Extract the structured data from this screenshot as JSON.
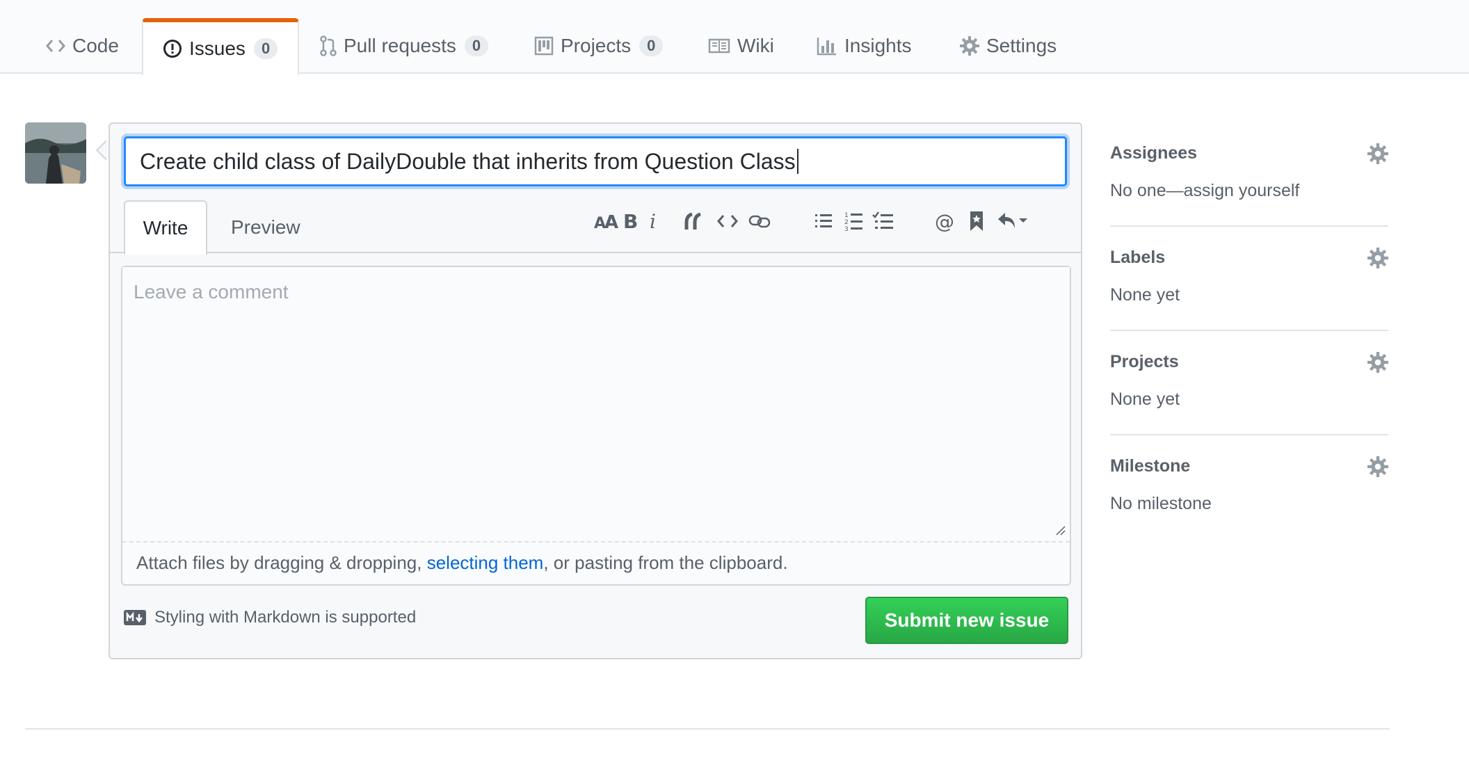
{
  "tabs": [
    {
      "label": "Code",
      "icon": "code-icon"
    },
    {
      "label": "Issues",
      "icon": "issue-opened-icon",
      "count": "0"
    },
    {
      "label": "Pull requests",
      "icon": "git-pull-request-icon",
      "count": "0"
    },
    {
      "label": "Projects",
      "icon": "project-icon",
      "count": "0"
    },
    {
      "label": "Wiki",
      "icon": "book-icon"
    },
    {
      "label": "Insights",
      "icon": "graph-icon"
    },
    {
      "label": "Settings",
      "icon": "gear-icon"
    }
  ],
  "issue": {
    "title_value": "Create child class of DailyDouble that inherits from Question Class",
    "write_tab": "Write",
    "preview_tab": "Preview",
    "comment_placeholder": "Leave a comment",
    "attach_prefix": "Attach files by dragging & dropping, ",
    "attach_link": "selecting them",
    "attach_suffix": ", or pasting from the clipboard.",
    "markdown_note": "Styling with Markdown is supported",
    "submit_label": "Submit new issue"
  },
  "toolbar": [
    "text-size-icon",
    "bold-icon",
    "italic-icon",
    "quote-icon",
    "code-icon",
    "link-icon",
    "unordered-list-icon",
    "ordered-list-icon",
    "task-list-icon",
    "mention-icon",
    "bookmark-icon",
    "reply-icon"
  ],
  "sidebar": [
    {
      "heading": "Assignees",
      "value": "No one—assign yourself"
    },
    {
      "heading": "Labels",
      "value": "None yet"
    },
    {
      "heading": "Projects",
      "value": "None yet"
    },
    {
      "heading": "Milestone",
      "value": "No milestone"
    }
  ],
  "colors": {
    "accent_tab": "#e36209",
    "submit": "#28a745",
    "link": "#0366d6",
    "focus": "#2188ff"
  }
}
